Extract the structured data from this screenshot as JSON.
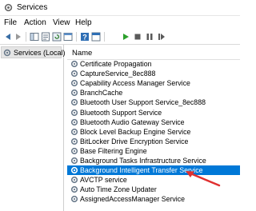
{
  "window": {
    "title": "Services"
  },
  "menu": [
    "File",
    "Action",
    "View",
    "Help"
  ],
  "toolbar": {
    "buttons": [
      "back-icon",
      "forward-icon",
      "show-hide-tree-icon",
      "properties-icon",
      "refresh-icon",
      "export-icon",
      "help-icon",
      "console-icon",
      "start-icon",
      "stop-icon",
      "pause-icon",
      "restart-icon"
    ]
  },
  "tree": {
    "root_label": "Services (Local)"
  },
  "list": {
    "column_header": "Name",
    "rows": [
      "Certificate Propagation",
      "CaptureService_8ec888",
      "Capability Access Manager Service",
      "BranchCache",
      "Bluetooth User Support Service_8ec888",
      "Bluetooth Support Service",
      "Bluetooth Audio Gateway Service",
      "Block Level Backup Engine Service",
      "BitLocker Drive Encryption Service",
      "Base Filtering Engine",
      "Background Tasks Infrastructure Service",
      "Background Intelligent Transfer Service",
      "AVCTP service",
      "Auto Time Zone Updater",
      "AssignedAccessManager Service"
    ],
    "selected_index": 11
  },
  "colors": {
    "selection": "#0078d7",
    "arrow": "#e03030",
    "start": "#2ca02c"
  }
}
